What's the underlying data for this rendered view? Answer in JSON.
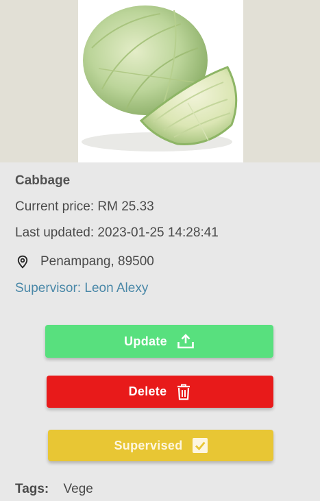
{
  "product": {
    "name": "Cabbage",
    "image_alt": "cabbage",
    "price_text": "Current price: RM 25.33",
    "last_updated_text": "Last updated: 2023-01-25 14:28:41",
    "location": "Penampang, 89500",
    "supervisor_text": "Supervisor: Leon Alexy"
  },
  "actions": {
    "update_label": "Update",
    "delete_label": "Delete",
    "supervised_label": "Supervised"
  },
  "tags": {
    "label": "Tags:",
    "value": "Vege"
  },
  "colors": {
    "update": "#58e07e",
    "delete": "#e81a1a",
    "supervised": "#e8c634",
    "supervisor_link": "#4a88a8",
    "background": "#e8e8e8"
  },
  "icons": {
    "location": "map-pin-icon",
    "update": "upload-icon",
    "delete": "trash-icon",
    "supervised": "checkbox-checked-icon"
  }
}
